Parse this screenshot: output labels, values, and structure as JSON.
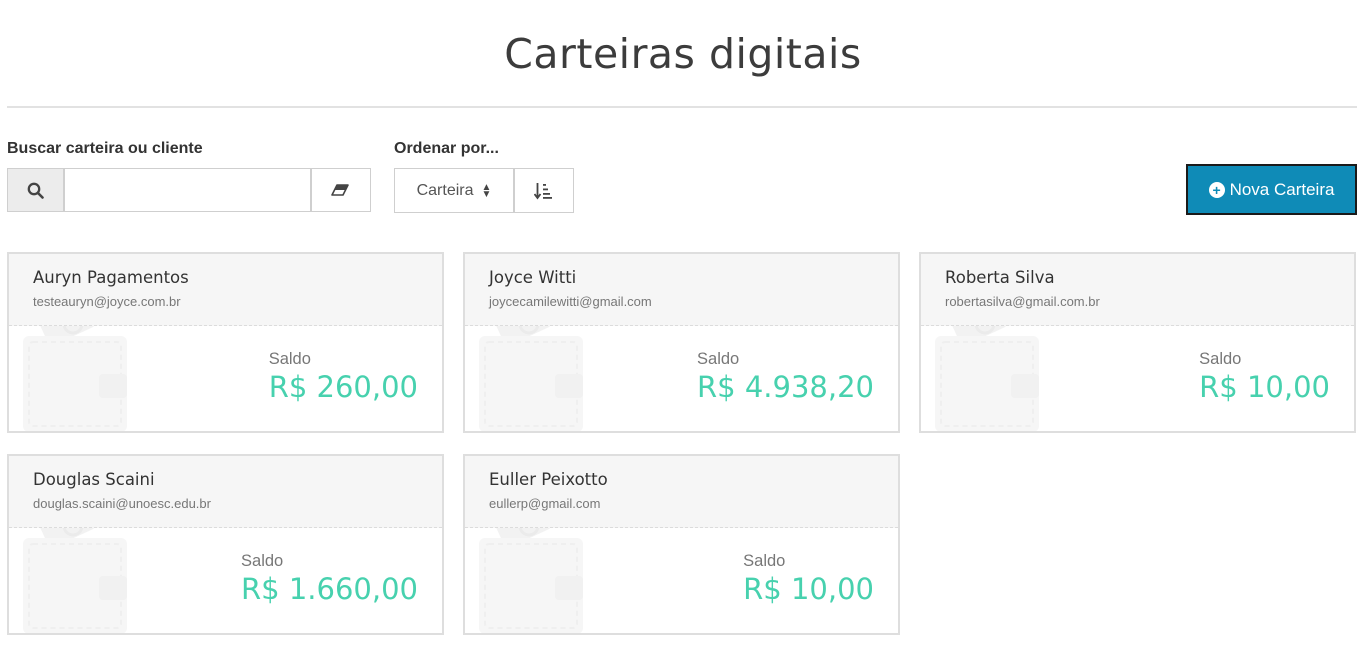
{
  "page": {
    "title": "Carteiras digitais"
  },
  "search": {
    "label": "Buscar carteira ou cliente",
    "value": "",
    "placeholder": ""
  },
  "order": {
    "label": "Ordenar por...",
    "selected": "Carteira"
  },
  "actions": {
    "new_wallet_label": "Nova Carteira"
  },
  "colors": {
    "accent": "#0f8bb7",
    "balance": "#47d1ae"
  },
  "icons": {
    "search": "search-icon",
    "clear": "eraser-icon",
    "sort": "sort-amount-icon",
    "add": "plus-circle-icon",
    "card_bg": "wallet-icon"
  },
  "wallets": [
    {
      "name": "Auryn Pagamentos",
      "email": "testeauryn@joyce.com.br",
      "balance_label": "Saldo",
      "balance": "R$ 260,00"
    },
    {
      "name": "Joyce Witti",
      "email": "joycecamilewitti@gmail.com",
      "balance_label": "Saldo",
      "balance": "R$ 4.938,20"
    },
    {
      "name": "Roberta Silva",
      "email": "robertasilva@gmail.com.br",
      "balance_label": "Saldo",
      "balance": "R$ 10,00"
    },
    {
      "name": "Douglas Scaini",
      "email": "douglas.scaini@unoesc.edu.br",
      "balance_label": "Saldo",
      "balance": "R$ 1.660,00"
    },
    {
      "name": "Euller Peixotto",
      "email": "eullerp@gmail.com",
      "balance_label": "Saldo",
      "balance": "R$ 10,00"
    }
  ]
}
